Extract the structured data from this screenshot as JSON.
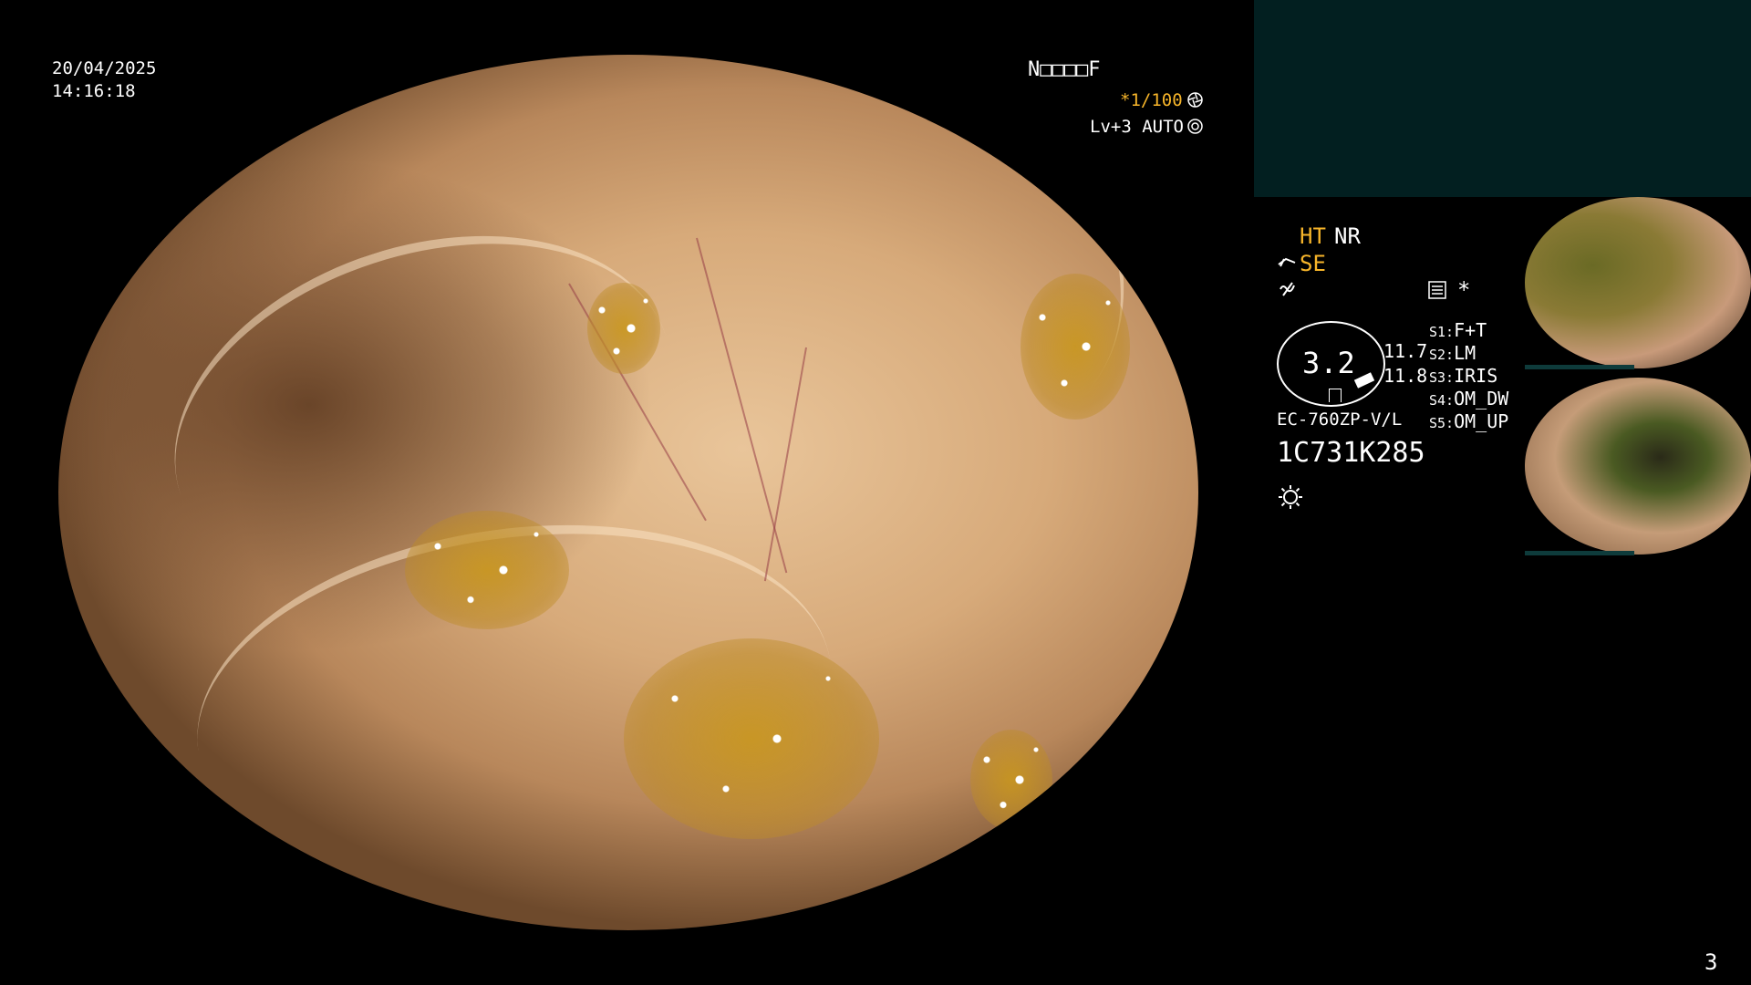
{
  "overlay": {
    "date": "20/04/2025",
    "time": "14:16:18",
    "patient_id": "N□□□□F",
    "shutter": "*1/100",
    "shutter_icon": "shutter-icon",
    "level": "Lv+3 AUTO",
    "iris_icon": "iris-icon",
    "page_number": "3"
  },
  "panel": {
    "ht": "HT",
    "nr": "NR",
    "se": "SE",
    "freeze_icon": "freeze-icon",
    "enhance_icon": "enhance-icon",
    "record_icon": "record-icon",
    "asterisk": "*",
    "zoom_value": "3.2",
    "scale_top": "11.7",
    "scale_bottom": "11.8",
    "scope_model": "EC-760ZP-V/L",
    "serial": "1C731K285",
    "light_icon": "light-icon",
    "switches": [
      {
        "key": "S1:",
        "value": "F+T"
      },
      {
        "key": "S2:",
        "value": "LM"
      },
      {
        "key": "S3:",
        "value": "IRIS"
      },
      {
        "key": "S4:",
        "value": "OM_DW"
      },
      {
        "key": "S5:",
        "value": "OM_UP"
      }
    ]
  },
  "colors": {
    "accent": "#f7b52a",
    "panel_teal": "#021f20",
    "mucosa": "#d7aa7a"
  }
}
